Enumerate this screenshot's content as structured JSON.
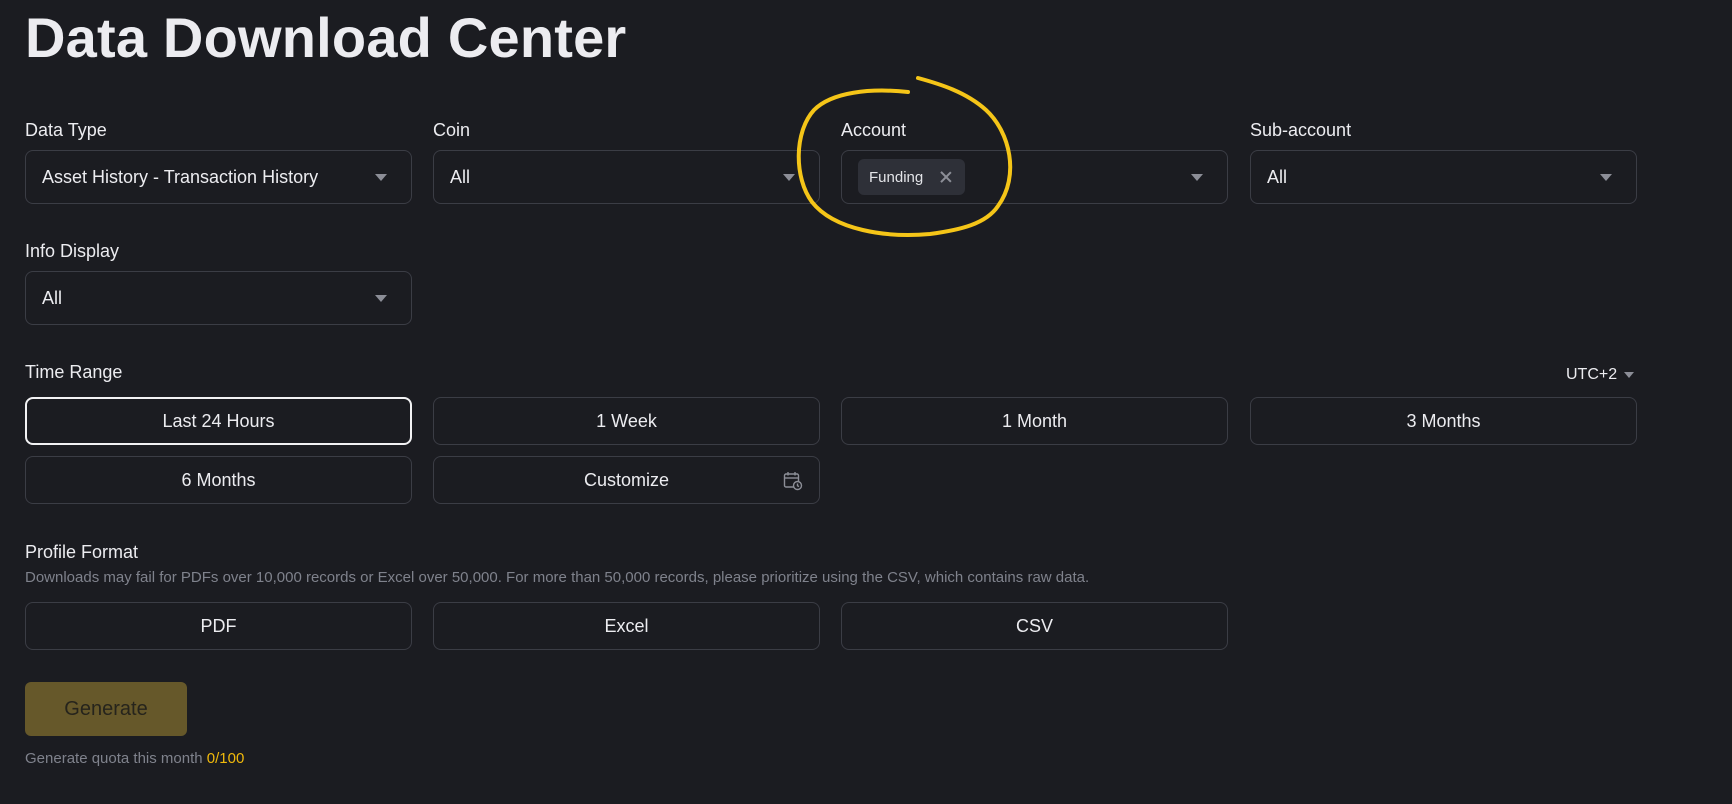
{
  "page": {
    "title": "Data Download Center"
  },
  "filters": {
    "data_type": {
      "label": "Data Type",
      "value": "Asset History - Transaction History"
    },
    "coin": {
      "label": "Coin",
      "value": "All"
    },
    "account": {
      "label": "Account",
      "selected_chip": "Funding"
    },
    "sub_account": {
      "label": "Sub-account",
      "value": "All"
    },
    "info_display": {
      "label": "Info Display",
      "value": "All"
    }
  },
  "time_range": {
    "label": "Time Range",
    "timezone": "UTC+2",
    "selected": "Last 24 Hours",
    "options": [
      "Last 24 Hours",
      "1 Week",
      "1 Month",
      "3 Months",
      "6 Months",
      "Customize"
    ]
  },
  "profile_format": {
    "label": "Profile Format",
    "note": "Downloads may fail for PDFs over 10,000 records or Excel over 50,000. For more than 50,000 records, please prioritize using the CSV, which contains raw data.",
    "options": [
      "PDF",
      "Excel",
      "CSV"
    ]
  },
  "generate": {
    "label": "Generate",
    "quota_text": "Generate quota this month",
    "quota_value": "0/100"
  },
  "colors": {
    "background": "#1b1c21",
    "accent": "#f0b90b",
    "annotation": "#f5c518",
    "border": "#3b3d45"
  },
  "icons": {
    "dropdown": "chevron-down-icon",
    "chip_remove": "close-icon",
    "calendar": "calendar-clock-icon"
  }
}
